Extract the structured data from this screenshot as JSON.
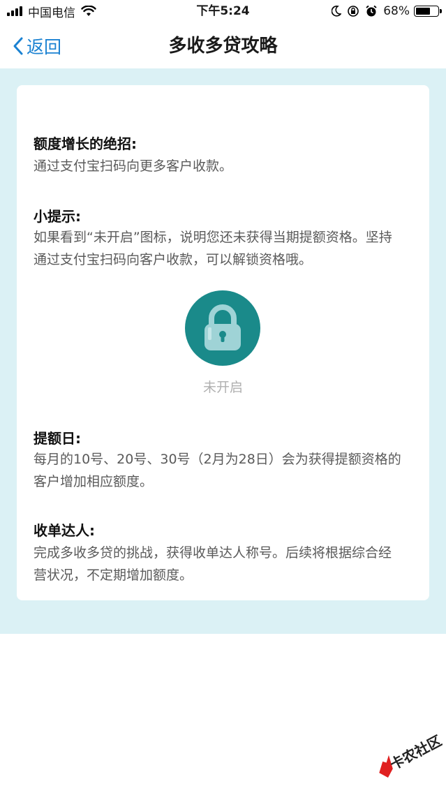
{
  "status_bar": {
    "carrier": "中国电信",
    "time": "下午5:24",
    "battery_percent_text": "68%",
    "battery_level": 0.68
  },
  "nav": {
    "back_label": "返回",
    "title": "多收多贷攻略"
  },
  "sections": [
    {
      "title": "额度增长的绝招:",
      "lines": [
        "通过支付宝扫码向更多客户收款。"
      ]
    },
    {
      "title": "小提示:",
      "lines": [
        "如果看到“未开启”图标，说明您还未获得当期提额资格。坚持",
        "通过支付宝扫码向客户收款，可以解锁资格哦。"
      ]
    },
    {
      "title": "提额日:",
      "lines": [
        "每月的10号、20号、30号（2月为28日）会为获得提额资格的",
        "客户增加相应额度。"
      ]
    },
    {
      "title": "收单达人:",
      "lines": [
        "完成多收多贷的挑战，获得收单达人称号。后续将根据综合经",
        "营状况，不定期增加额度。"
      ]
    }
  ],
  "lock": {
    "caption": "未开启",
    "circle_color": "#1a8a8a",
    "lock_color": "#9fd3d6"
  },
  "watermark": {
    "text": "卡农社区"
  },
  "colors": {
    "accent": "#1b82d2",
    "background": "#dbf1f5"
  }
}
